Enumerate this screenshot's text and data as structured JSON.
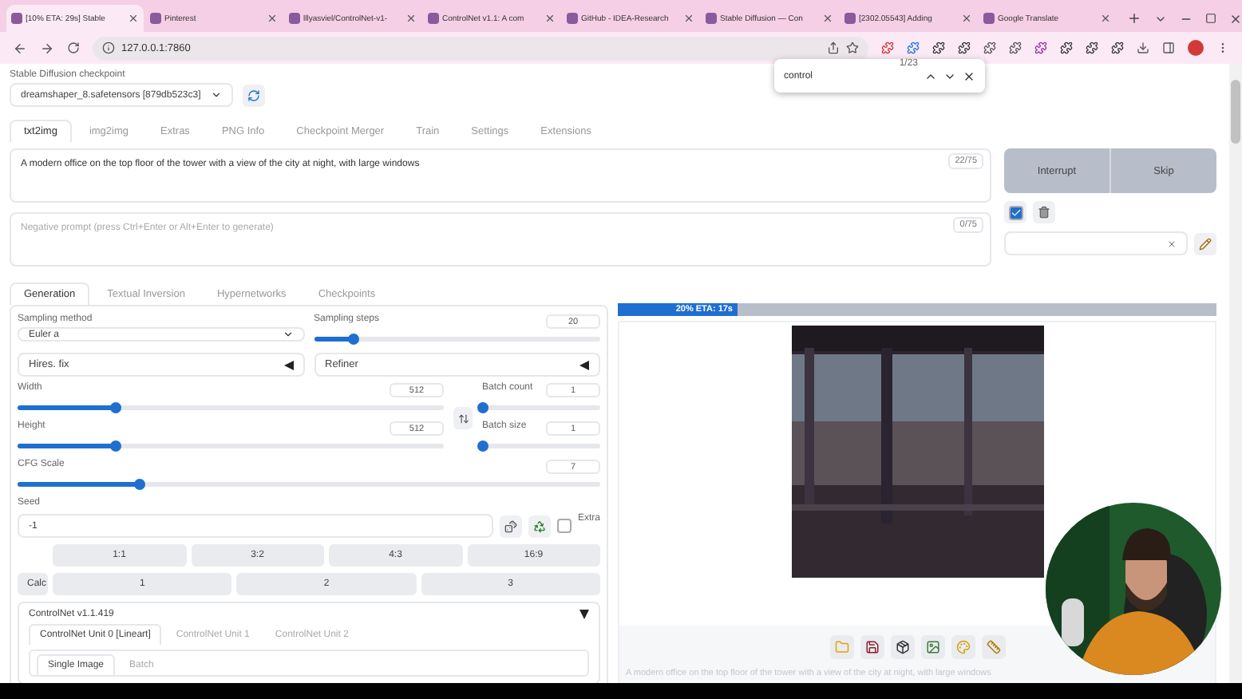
{
  "browser_tabs": [
    {
      "title": "[10% ETA: 29s] Stable",
      "selected": true
    },
    {
      "title": "Pinterest",
      "selected": false
    },
    {
      "title": "lllyasviel/ControlNet-v1-",
      "selected": false
    },
    {
      "title": "ControlNet v1.1: A com",
      "selected": false
    },
    {
      "title": "GitHub - IDEA-Research",
      "selected": false
    },
    {
      "title": "Stable Diffusion — Con",
      "selected": false
    },
    {
      "title": "[2302.05543] Adding",
      "selected": false
    },
    {
      "title": "Google Translate",
      "selected": false
    }
  ],
  "address": "127.0.0.1:7860",
  "find_bar": {
    "query": "control",
    "count": "1/23"
  },
  "checkpoint": {
    "label": "Stable Diffusion checkpoint",
    "value": "dreamshaper_8.safetensors [879db523c3]"
  },
  "main_tabs": [
    {
      "label": "txt2img",
      "selected": true
    },
    {
      "label": "img2img",
      "selected": false
    },
    {
      "label": "Extras",
      "selected": false
    },
    {
      "label": "PNG Info",
      "selected": false
    },
    {
      "label": "Checkpoint Merger",
      "selected": false
    },
    {
      "label": "Train",
      "selected": false
    },
    {
      "label": "Settings",
      "selected": false
    },
    {
      "label": "Extensions",
      "selected": false
    }
  ],
  "prompt": {
    "value": "A modern office on the top floor of the tower with a view of the city at night, with large windows",
    "counter": "22/75"
  },
  "negative_prompt": {
    "placeholder": "Negative prompt (press Ctrl+Enter or Alt+Enter to generate)",
    "counter": "0/75"
  },
  "actions": [
    "Interrupt",
    "Skip"
  ],
  "style_apply": {
    "checked": true
  },
  "sub_tabs": [
    {
      "label": "Generation",
      "selected": true
    },
    {
      "label": "Textual Inversion",
      "selected": false
    },
    {
      "label": "Hypernetworks",
      "selected": false
    },
    {
      "label": "Checkpoints",
      "selected": false
    }
  ],
  "sampling_method": {
    "label": "Sampling method",
    "value": "Euler a"
  },
  "sampling_steps": {
    "label": "Sampling steps",
    "value": "20",
    "level": 0.14
  },
  "accordions": [
    "Hires. fix",
    "Refiner"
  ],
  "width": {
    "label": "Width",
    "value": "512",
    "level": 0.23
  },
  "height": {
    "label": "Height",
    "value": "512",
    "level": 0.23
  },
  "batch_count": {
    "label": "Batch count",
    "value": "1",
    "level": 0
  },
  "batch_size": {
    "label": "Batch size",
    "value": "1",
    "level": 0
  },
  "cfg_scale": {
    "label": "CFG Scale",
    "value": "7",
    "level": 0.21
  },
  "seed": {
    "label": "Seed",
    "value": "-1"
  },
  "extra": {
    "label": "Extra",
    "checked": false
  },
  "ratio_buttons": [
    "1:1",
    "3:2",
    "4:3",
    "16:9"
  ],
  "calc": {
    "label": "Calc",
    "buttons": [
      "1",
      "2",
      "3"
    ]
  },
  "controlnet": {
    "title": "ControlNet v1.1.419",
    "units": [
      {
        "label": "ControlNet Unit 0 [Lineart]",
        "selected": true
      },
      {
        "label": "ControlNet Unit 1",
        "selected": false
      },
      {
        "label": "ControlNet Unit 2",
        "selected": false
      }
    ],
    "image_tabs": [
      {
        "label": "Single Image",
        "selected": true
      },
      {
        "label": "Batch",
        "selected": false
      }
    ]
  },
  "progress": {
    "text": "20% ETA: 17s",
    "level": 0.2
  },
  "output_image": {
    "kind": "picture"
  },
  "caption": "A modern office on the top floor of the tower with a view of the city at night, with large windows",
  "webcam": {
    "kind": "picture"
  }
}
